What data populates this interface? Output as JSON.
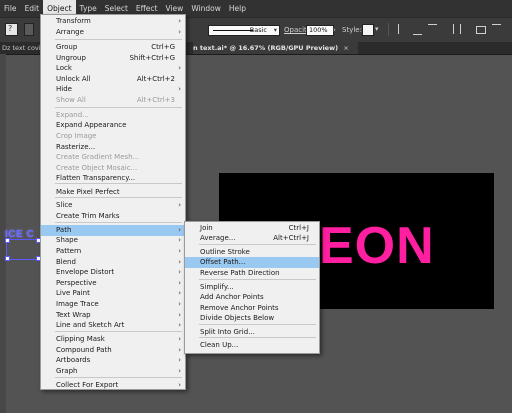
{
  "menubar": [
    "File",
    "Edit",
    "Object",
    "Type",
    "Select",
    "Effect",
    "View",
    "Window",
    "Help"
  ],
  "control": {
    "stroke_style": "Basic",
    "opacity_label": "Opacity:",
    "opacity_value": "100%",
    "style_label": "Style:"
  },
  "tabs": {
    "left": "Dz text covid",
    "main": "n text.ai* @ 16.67% (RGB/GPU Preview)",
    "close": "×"
  },
  "canvas": {
    "artboard_text": "EON",
    "selected_text": "ICE C"
  },
  "object_menu": {
    "items": [
      {
        "label": "Transform",
        "shortcut": "",
        "arrow": "›"
      },
      {
        "label": "Arrange",
        "shortcut": "",
        "arrow": "›"
      },
      {
        "label": "Group",
        "shortcut": "Ctrl+G",
        "arrow": ""
      },
      {
        "label": "Ungroup",
        "shortcut": "Shift+Ctrl+G",
        "arrow": ""
      },
      {
        "label": "Lock",
        "shortcut": "",
        "arrow": "›"
      },
      {
        "label": "Unlock All",
        "shortcut": "Alt+Ctrl+2",
        "arrow": ""
      },
      {
        "label": "Hide",
        "shortcut": "",
        "arrow": "›"
      },
      {
        "label": "Show All",
        "shortcut": "Alt+Ctrl+3",
        "arrow": ""
      },
      {
        "label": "Expand...",
        "shortcut": "",
        "arrow": ""
      },
      {
        "label": "Expand Appearance",
        "shortcut": "",
        "arrow": ""
      },
      {
        "label": "Crop Image",
        "shortcut": "",
        "arrow": ""
      },
      {
        "label": "Rasterize...",
        "shortcut": "",
        "arrow": ""
      },
      {
        "label": "Create Gradient Mesh...",
        "shortcut": "",
        "arrow": ""
      },
      {
        "label": "Create Object Mosaic...",
        "shortcut": "",
        "arrow": ""
      },
      {
        "label": "Flatten Transparency...",
        "shortcut": "",
        "arrow": ""
      },
      {
        "label": "Make Pixel Perfect",
        "shortcut": "",
        "arrow": ""
      },
      {
        "label": "Slice",
        "shortcut": "",
        "arrow": "›"
      },
      {
        "label": "Create Trim Marks",
        "shortcut": "",
        "arrow": ""
      },
      {
        "label": "Path",
        "shortcut": "",
        "arrow": "›"
      },
      {
        "label": "Shape",
        "shortcut": "",
        "arrow": "›"
      },
      {
        "label": "Pattern",
        "shortcut": "",
        "arrow": "›"
      },
      {
        "label": "Blend",
        "shortcut": "",
        "arrow": "›"
      },
      {
        "label": "Envelope Distort",
        "shortcut": "",
        "arrow": "›"
      },
      {
        "label": "Perspective",
        "shortcut": "",
        "arrow": "›"
      },
      {
        "label": "Live Paint",
        "shortcut": "",
        "arrow": "›"
      },
      {
        "label": "Image Trace",
        "shortcut": "",
        "arrow": "›"
      },
      {
        "label": "Text Wrap",
        "shortcut": "",
        "arrow": "›"
      },
      {
        "label": "Line and Sketch Art",
        "shortcut": "",
        "arrow": "›"
      },
      {
        "label": "Clipping Mask",
        "shortcut": "",
        "arrow": "›"
      },
      {
        "label": "Compound Path",
        "shortcut": "",
        "arrow": "›"
      },
      {
        "label": "Artboards",
        "shortcut": "",
        "arrow": "›"
      },
      {
        "label": "Graph",
        "shortcut": "",
        "arrow": "›"
      },
      {
        "label": "Collect For Export",
        "shortcut": "",
        "arrow": "›"
      }
    ]
  },
  "path_menu": {
    "items": [
      {
        "label": "Join",
        "shortcut": "Ctrl+J"
      },
      {
        "label": "Average...",
        "shortcut": "Alt+Ctrl+J"
      },
      {
        "label": "Outline Stroke",
        "shortcut": ""
      },
      {
        "label": "Offset Path...",
        "shortcut": ""
      },
      {
        "label": "Reverse Path Direction",
        "shortcut": ""
      },
      {
        "label": "Simplify...",
        "shortcut": ""
      },
      {
        "label": "Add Anchor Points",
        "shortcut": ""
      },
      {
        "label": "Remove Anchor Points",
        "shortcut": ""
      },
      {
        "label": "Divide Objects Below",
        "shortcut": ""
      },
      {
        "label": "Split Into Grid...",
        "shortcut": ""
      },
      {
        "label": "Clean Up...",
        "shortcut": ""
      }
    ]
  }
}
